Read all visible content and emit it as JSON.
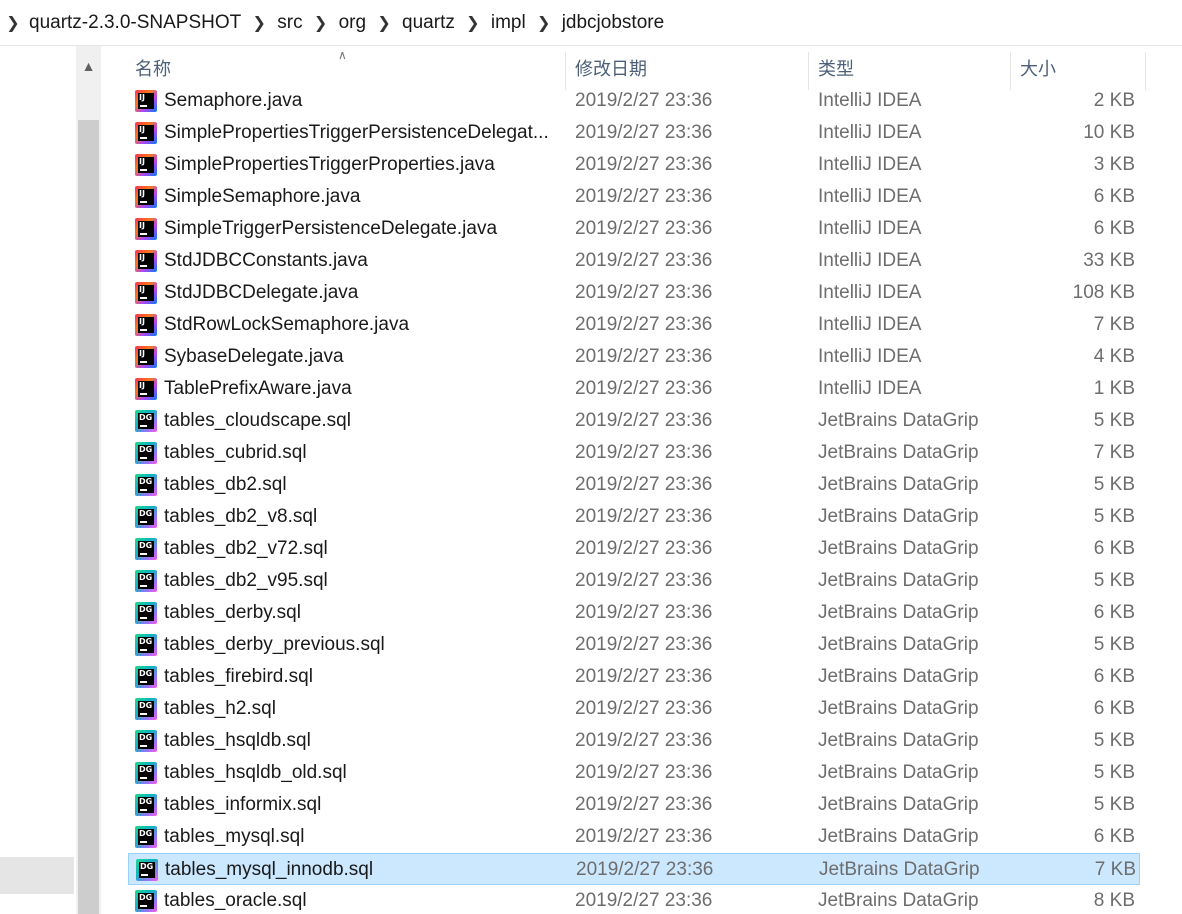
{
  "breadcrumb": [
    "quartz-2.3.0-SNAPSHOT",
    "src",
    "org",
    "quartz",
    "impl",
    "jdbcjobstore"
  ],
  "columns": {
    "name": "名称",
    "date": "修改日期",
    "type": "类型",
    "size": "大小"
  },
  "selected_index": 24,
  "files": [
    {
      "name": "Semaphore.java",
      "date": "2019/2/27 23:36",
      "type": "IntelliJ IDEA",
      "size": "2 KB",
      "icon": "intellij-idea-file-icon"
    },
    {
      "name": "SimplePropertiesTriggerPersistenceDelegat...",
      "date": "2019/2/27 23:36",
      "type": "IntelliJ IDEA",
      "size": "10 KB",
      "icon": "intellij-idea-file-icon"
    },
    {
      "name": "SimplePropertiesTriggerProperties.java",
      "date": "2019/2/27 23:36",
      "type": "IntelliJ IDEA",
      "size": "3 KB",
      "icon": "intellij-idea-file-icon"
    },
    {
      "name": "SimpleSemaphore.java",
      "date": "2019/2/27 23:36",
      "type": "IntelliJ IDEA",
      "size": "6 KB",
      "icon": "intellij-idea-file-icon"
    },
    {
      "name": "SimpleTriggerPersistenceDelegate.java",
      "date": "2019/2/27 23:36",
      "type": "IntelliJ IDEA",
      "size": "6 KB",
      "icon": "intellij-idea-file-icon"
    },
    {
      "name": "StdJDBCConstants.java",
      "date": "2019/2/27 23:36",
      "type": "IntelliJ IDEA",
      "size": "33 KB",
      "icon": "intellij-idea-file-icon"
    },
    {
      "name": "StdJDBCDelegate.java",
      "date": "2019/2/27 23:36",
      "type": "IntelliJ IDEA",
      "size": "108 KB",
      "icon": "intellij-idea-file-icon"
    },
    {
      "name": "StdRowLockSemaphore.java",
      "date": "2019/2/27 23:36",
      "type": "IntelliJ IDEA",
      "size": "7 KB",
      "icon": "intellij-idea-file-icon"
    },
    {
      "name": "SybaseDelegate.java",
      "date": "2019/2/27 23:36",
      "type": "IntelliJ IDEA",
      "size": "4 KB",
      "icon": "intellij-idea-file-icon"
    },
    {
      "name": "TablePrefixAware.java",
      "date": "2019/2/27 23:36",
      "type": "IntelliJ IDEA",
      "size": "1 KB",
      "icon": "intellij-idea-file-icon"
    },
    {
      "name": "tables_cloudscape.sql",
      "date": "2019/2/27 23:36",
      "type": "JetBrains DataGrip",
      "size": "5 KB",
      "icon": "datagrip-file-icon"
    },
    {
      "name": "tables_cubrid.sql",
      "date": "2019/2/27 23:36",
      "type": "JetBrains DataGrip",
      "size": "7 KB",
      "icon": "datagrip-file-icon"
    },
    {
      "name": "tables_db2.sql",
      "date": "2019/2/27 23:36",
      "type": "JetBrains DataGrip",
      "size": "5 KB",
      "icon": "datagrip-file-icon"
    },
    {
      "name": "tables_db2_v8.sql",
      "date": "2019/2/27 23:36",
      "type": "JetBrains DataGrip",
      "size": "5 KB",
      "icon": "datagrip-file-icon"
    },
    {
      "name": "tables_db2_v72.sql",
      "date": "2019/2/27 23:36",
      "type": "JetBrains DataGrip",
      "size": "6 KB",
      "icon": "datagrip-file-icon"
    },
    {
      "name": "tables_db2_v95.sql",
      "date": "2019/2/27 23:36",
      "type": "JetBrains DataGrip",
      "size": "5 KB",
      "icon": "datagrip-file-icon"
    },
    {
      "name": "tables_derby.sql",
      "date": "2019/2/27 23:36",
      "type": "JetBrains DataGrip",
      "size": "6 KB",
      "icon": "datagrip-file-icon"
    },
    {
      "name": "tables_derby_previous.sql",
      "date": "2019/2/27 23:36",
      "type": "JetBrains DataGrip",
      "size": "5 KB",
      "icon": "datagrip-file-icon"
    },
    {
      "name": "tables_firebird.sql",
      "date": "2019/2/27 23:36",
      "type": "JetBrains DataGrip",
      "size": "6 KB",
      "icon": "datagrip-file-icon"
    },
    {
      "name": "tables_h2.sql",
      "date": "2019/2/27 23:36",
      "type": "JetBrains DataGrip",
      "size": "6 KB",
      "icon": "datagrip-file-icon"
    },
    {
      "name": "tables_hsqldb.sql",
      "date": "2019/2/27 23:36",
      "type": "JetBrains DataGrip",
      "size": "5 KB",
      "icon": "datagrip-file-icon"
    },
    {
      "name": "tables_hsqldb_old.sql",
      "date": "2019/2/27 23:36",
      "type": "JetBrains DataGrip",
      "size": "5 KB",
      "icon": "datagrip-file-icon"
    },
    {
      "name": "tables_informix.sql",
      "date": "2019/2/27 23:36",
      "type": "JetBrains DataGrip",
      "size": "5 KB",
      "icon": "datagrip-file-icon"
    },
    {
      "name": "tables_mysql.sql",
      "date": "2019/2/27 23:36",
      "type": "JetBrains DataGrip",
      "size": "6 KB",
      "icon": "datagrip-file-icon"
    },
    {
      "name": "tables_mysql_innodb.sql",
      "date": "2019/2/27 23:36",
      "type": "JetBrains DataGrip",
      "size": "7 KB",
      "icon": "datagrip-file-icon"
    },
    {
      "name": "tables_oracle.sql",
      "date": "2019/2/27 23:36",
      "type": "JetBrains DataGrip",
      "size": "8 KB",
      "icon": "datagrip-file-icon"
    }
  ],
  "icon_glyphs": {
    "intellij-idea-file-icon": "IJ",
    "datagrip-file-icon": "DG"
  },
  "colors": {
    "selection_background": "#cce8ff",
    "selection_border": "#99d1ff",
    "header_text": "#4c607a",
    "secondary_text": "#6d6d6d"
  }
}
